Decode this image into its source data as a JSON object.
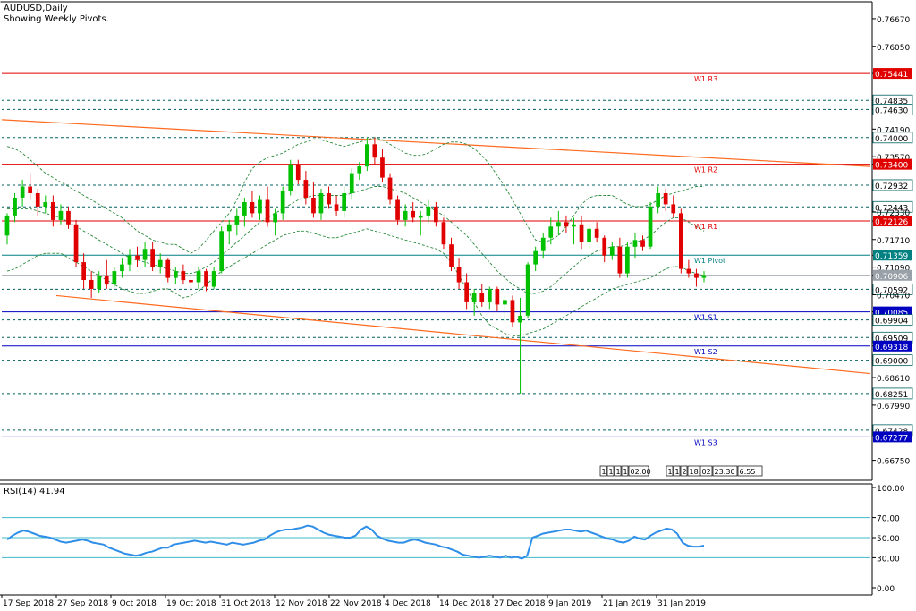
{
  "header": {
    "symbol_line": "AUDUSD,Daily",
    "pivots_line": "Showing Weekly Pivots."
  },
  "indicator": {
    "label": "RSI(14) 41.94"
  },
  "colors": {
    "bull": "#00c000",
    "bear": "#e00000",
    "pivot_res": "#e00000",
    "pivot_sup": "#0000c0",
    "pivot_mid": "#008080",
    "level": "#006060",
    "trend": "#ff6a1f",
    "band": "#2a8a3a",
    "rsi_line": "#2f8fe8",
    "rsi_level": "#40b8c8",
    "axis": "#000000"
  },
  "chart_data": [
    {
      "type": "candlestick",
      "title": "AUDUSD,Daily",
      "subtitle": "Showing Weekly Pivots.",
      "ylim": [
        0.663,
        0.7705
      ],
      "y_ticks": [
        "0.76670",
        "0.76050",
        "0.75441",
        "0.74835",
        "0.74630",
        "0.74190",
        "0.74000",
        "0.73570",
        "0.73400",
        "0.72932",
        "0.72443",
        "0.72330",
        "0.72126",
        "0.71710",
        "0.71359",
        "0.71090",
        "0.70906",
        "0.70592",
        "0.70470",
        "0.70085",
        "0.69904",
        "0.69509",
        "0.69318",
        "0.69000",
        "0.68610",
        "0.68251",
        "0.67990",
        "0.67428",
        "0.67277",
        "0.66750"
      ],
      "pivot_levels": [
        {
          "label": "W1 R3",
          "value": 0.75441,
          "kind": "res"
        },
        {
          "label": "W1 R2",
          "value": 0.734,
          "kind": "res"
        },
        {
          "label": "W1 R1",
          "value": 0.72126,
          "kind": "res"
        },
        {
          "label": "W1 Pivot",
          "value": 0.71359,
          "kind": "mid"
        },
        {
          "label": "W1 S1",
          "value": 0.70085,
          "kind": "sup"
        },
        {
          "label": "W1 S2",
          "value": 0.69318,
          "kind": "sup"
        },
        {
          "label": "W1 S3",
          "value": 0.67277,
          "kind": "sup"
        }
      ],
      "horizontal_levels": [
        0.74835,
        0.7463,
        0.74,
        0.72932,
        0.72443,
        0.70592,
        0.69904,
        0.69509,
        0.69,
        0.68251,
        0.67428
      ],
      "current_price": 0.70906,
      "x_labels": [
        "17 Sep 2018",
        "27 Sep 2018",
        "9 Oct 2018",
        "19 Oct 2018",
        "31 Oct 2018",
        "12 Nov 2018",
        "22 Nov 2018",
        "4 Dec 2018",
        "14 Dec 2018",
        "27 Dec 2018",
        "9 Jan 2019",
        "21 Jan 2019",
        "31 Jan 2019"
      ],
      "trendlines": [
        {
          "from": [
            "17 Sep 2018",
            0.744
          ],
          "to": [
            "end",
            0.7335
          ]
        },
        {
          "from": [
            "27 Sep 2018",
            0.7045
          ],
          "to": [
            "end",
            0.687
          ]
        }
      ],
      "session_labels": [
        "1",
        "1",
        "1",
        "1",
        "02:00",
        "1",
        "1",
        "2",
        "18:",
        "02",
        "23:30",
        "6:55"
      ],
      "candles": [
        [
          0.718,
          0.723,
          0.716,
          0.7225
        ],
        [
          0.7225,
          0.7275,
          0.721,
          0.7265
        ],
        [
          0.7265,
          0.7305,
          0.7245,
          0.729
        ],
        [
          0.729,
          0.732,
          0.726,
          0.7275
        ],
        [
          0.7275,
          0.7285,
          0.7225,
          0.7245
        ],
        [
          0.7245,
          0.727,
          0.723,
          0.7255
        ],
        [
          0.7255,
          0.727,
          0.72,
          0.7215
        ],
        [
          0.7215,
          0.725,
          0.7205,
          0.7235
        ],
        [
          0.7235,
          0.7245,
          0.7195,
          0.7205
        ],
        [
          0.7205,
          0.7215,
          0.711,
          0.712
        ],
        [
          0.712,
          0.714,
          0.706,
          0.708
        ],
        [
          0.708,
          0.71,
          0.704,
          0.706
        ],
        [
          0.706,
          0.71,
          0.705,
          0.709
        ],
        [
          0.709,
          0.7125,
          0.706,
          0.707
        ],
        [
          0.707,
          0.711,
          0.7065,
          0.71
        ],
        [
          0.71,
          0.713,
          0.7085,
          0.7115
        ],
        [
          0.7115,
          0.715,
          0.71,
          0.7135
        ],
        [
          0.7135,
          0.7155,
          0.711,
          0.7125
        ],
        [
          0.7125,
          0.7165,
          0.711,
          0.715
        ],
        [
          0.715,
          0.7165,
          0.71,
          0.711
        ],
        [
          0.711,
          0.714,
          0.7095,
          0.7125
        ],
        [
          0.7125,
          0.713,
          0.7075,
          0.7085
        ],
        [
          0.7085,
          0.711,
          0.707,
          0.71
        ],
        [
          0.71,
          0.7115,
          0.707,
          0.708
        ],
        [
          0.708,
          0.7095,
          0.704,
          0.7075
        ],
        [
          0.7075,
          0.711,
          0.706,
          0.71
        ],
        [
          0.71,
          0.7105,
          0.7055,
          0.7065
        ],
        [
          0.7065,
          0.711,
          0.706,
          0.71
        ],
        [
          0.71,
          0.72,
          0.7095,
          0.719
        ],
        [
          0.719,
          0.7215,
          0.716,
          0.7205
        ],
        [
          0.7205,
          0.724,
          0.718,
          0.7225
        ],
        [
          0.7225,
          0.7265,
          0.72,
          0.7255
        ],
        [
          0.7255,
          0.728,
          0.722,
          0.723
        ],
        [
          0.723,
          0.727,
          0.7215,
          0.726
        ],
        [
          0.726,
          0.729,
          0.72,
          0.721
        ],
        [
          0.721,
          0.724,
          0.718,
          0.723
        ],
        [
          0.723,
          0.729,
          0.7215,
          0.728
        ],
        [
          0.728,
          0.735,
          0.727,
          0.734
        ],
        [
          0.734,
          0.735,
          0.7295,
          0.7305
        ],
        [
          0.7305,
          0.7325,
          0.725,
          0.7265
        ],
        [
          0.7265,
          0.73,
          0.722,
          0.723
        ],
        [
          0.723,
          0.7285,
          0.7215,
          0.7275
        ],
        [
          0.7275,
          0.729,
          0.724,
          0.725
        ],
        [
          0.725,
          0.727,
          0.7225,
          0.7235
        ],
        [
          0.7235,
          0.729,
          0.722,
          0.7275
        ],
        [
          0.7275,
          0.733,
          0.726,
          0.732
        ],
        [
          0.732,
          0.7345,
          0.7305,
          0.7335
        ],
        [
          0.7335,
          0.74,
          0.7325,
          0.7385
        ],
        [
          0.7385,
          0.74,
          0.734,
          0.7355
        ],
        [
          0.7355,
          0.7375,
          0.73,
          0.731
        ],
        [
          0.731,
          0.732,
          0.725,
          0.726
        ],
        [
          0.726,
          0.727,
          0.7205,
          0.7215
        ],
        [
          0.7215,
          0.725,
          0.72,
          0.7235
        ],
        [
          0.7235,
          0.7255,
          0.721,
          0.722
        ],
        [
          0.722,
          0.7235,
          0.718,
          0.7225
        ],
        [
          0.7225,
          0.726,
          0.721,
          0.7245
        ],
        [
          0.7245,
          0.7255,
          0.72,
          0.721
        ],
        [
          0.721,
          0.722,
          0.715,
          0.716
        ],
        [
          0.716,
          0.7175,
          0.71,
          0.711
        ],
        [
          0.711,
          0.713,
          0.706,
          0.7075
        ],
        [
          0.7075,
          0.7095,
          0.7015,
          0.703
        ],
        [
          0.703,
          0.706,
          0.7,
          0.705
        ],
        [
          0.705,
          0.707,
          0.702,
          0.703
        ],
        [
          0.703,
          0.7065,
          0.7015,
          0.706
        ],
        [
          0.706,
          0.7065,
          0.701,
          0.7025
        ],
        [
          0.7025,
          0.7045,
          0.6985,
          0.7035
        ],
        [
          0.7035,
          0.7045,
          0.6975,
          0.6985
        ],
        [
          0.6985,
          0.704,
          0.6825,
          0.7
        ],
        [
          0.7,
          0.712,
          0.6995,
          0.7115
        ],
        [
          0.7115,
          0.7155,
          0.71,
          0.7145
        ],
        [
          0.7145,
          0.7185,
          0.713,
          0.7175
        ],
        [
          0.7175,
          0.722,
          0.716,
          0.72
        ],
        [
          0.72,
          0.7235,
          0.718,
          0.721
        ],
        [
          0.721,
          0.7225,
          0.7185,
          0.72
        ],
        [
          0.72,
          0.722,
          0.716,
          0.7205
        ],
        [
          0.7205,
          0.7225,
          0.715,
          0.7165
        ],
        [
          0.7165,
          0.7205,
          0.715,
          0.7195
        ],
        [
          0.7195,
          0.721,
          0.7165,
          0.7175
        ],
        [
          0.7175,
          0.718,
          0.712,
          0.7135
        ],
        [
          0.7135,
          0.7165,
          0.7125,
          0.7155
        ],
        [
          0.7155,
          0.7175,
          0.7085,
          0.7095
        ],
        [
          0.7095,
          0.7165,
          0.7085,
          0.7155
        ],
        [
          0.7155,
          0.7185,
          0.713,
          0.717
        ],
        [
          0.717,
          0.718,
          0.7145,
          0.7155
        ],
        [
          0.7155,
          0.7255,
          0.715,
          0.7245
        ],
        [
          0.7245,
          0.729,
          0.723,
          0.7275
        ],
        [
          0.7275,
          0.7285,
          0.7235,
          0.725
        ],
        [
          0.725,
          0.727,
          0.722,
          0.723
        ],
        [
          0.723,
          0.724,
          0.7095,
          0.7105
        ],
        [
          0.7105,
          0.7125,
          0.7085,
          0.7095
        ],
        [
          0.7095,
          0.7105,
          0.7065,
          0.7085
        ],
        [
          0.7085,
          0.71,
          0.7075,
          0.7091
        ]
      ],
      "band_upper": [
        0.738,
        0.7375,
        0.7365,
        0.735,
        0.7335,
        0.732,
        0.731,
        0.73,
        0.729,
        0.728,
        0.727,
        0.726,
        0.725,
        0.724,
        0.723,
        0.722,
        0.7205,
        0.719,
        0.718,
        0.717,
        0.7165,
        0.716,
        0.716,
        0.715,
        0.714,
        0.715,
        0.717,
        0.719,
        0.721,
        0.723,
        0.726,
        0.73,
        0.733,
        0.7345,
        0.7355,
        0.736,
        0.7365,
        0.7375,
        0.7385,
        0.739,
        0.7395,
        0.7395,
        0.739,
        0.7385,
        0.738,
        0.7385,
        0.739,
        0.7395,
        0.74,
        0.7395,
        0.7385,
        0.7375,
        0.7365,
        0.736,
        0.736,
        0.7365,
        0.7375,
        0.7385,
        0.739,
        0.739,
        0.7385,
        0.7375,
        0.736,
        0.734,
        0.7315,
        0.729,
        0.726,
        0.723,
        0.72,
        0.717,
        0.7165,
        0.717,
        0.718,
        0.72,
        0.7225,
        0.725,
        0.7265,
        0.727,
        0.727,
        0.727,
        0.726,
        0.725,
        0.7245,
        0.7245,
        0.725,
        0.726,
        0.727,
        0.7275,
        0.728,
        0.7285,
        0.729,
        0.729
      ],
      "band_middle": [
        0.724,
        0.724,
        0.724,
        0.724,
        0.7235,
        0.723,
        0.7225,
        0.722,
        0.721,
        0.72,
        0.719,
        0.718,
        0.717,
        0.716,
        0.715,
        0.714,
        0.713,
        0.7125,
        0.712,
        0.7115,
        0.711,
        0.7105,
        0.71,
        0.7095,
        0.7095,
        0.71,
        0.711,
        0.712,
        0.7135,
        0.715,
        0.7165,
        0.718,
        0.7195,
        0.721,
        0.722,
        0.723,
        0.724,
        0.725,
        0.726,
        0.7265,
        0.727,
        0.727,
        0.727,
        0.727,
        0.727,
        0.7275,
        0.728,
        0.7285,
        0.729,
        0.729,
        0.7285,
        0.728,
        0.7275,
        0.7265,
        0.7255,
        0.7245,
        0.7235,
        0.7225,
        0.721,
        0.7195,
        0.718,
        0.716,
        0.714,
        0.712,
        0.71,
        0.7085,
        0.707,
        0.706,
        0.705,
        0.705,
        0.7055,
        0.7065,
        0.708,
        0.7095,
        0.711,
        0.7125,
        0.7135,
        0.7145,
        0.715,
        0.7155,
        0.7155,
        0.716,
        0.7165,
        0.717,
        0.718,
        0.7195,
        0.721,
        0.722,
        0.722,
        0.721,
        0.72,
        0.719
      ],
      "band_lower": [
        0.71,
        0.7105,
        0.7115,
        0.7125,
        0.7135,
        0.714,
        0.714,
        0.714,
        0.713,
        0.712,
        0.711,
        0.71,
        0.709,
        0.708,
        0.707,
        0.706,
        0.7055,
        0.705,
        0.705,
        0.7055,
        0.706,
        0.706,
        0.705,
        0.704,
        0.7045,
        0.7055,
        0.707,
        0.7085,
        0.71,
        0.711,
        0.712,
        0.713,
        0.714,
        0.715,
        0.716,
        0.717,
        0.718,
        0.7185,
        0.719,
        0.719,
        0.7185,
        0.718,
        0.7175,
        0.7175,
        0.718,
        0.7185,
        0.719,
        0.7195,
        0.719,
        0.7185,
        0.718,
        0.7175,
        0.717,
        0.7165,
        0.716,
        0.7155,
        0.715,
        0.714,
        0.712,
        0.709,
        0.706,
        0.703,
        0.7,
        0.698,
        0.697,
        0.696,
        0.6955,
        0.6955,
        0.696,
        0.6965,
        0.697,
        0.698,
        0.699,
        0.7,
        0.701,
        0.702,
        0.703,
        0.704,
        0.705,
        0.706,
        0.7065,
        0.707,
        0.7075,
        0.708,
        0.7085,
        0.7095,
        0.7105,
        0.711,
        0.711,
        0.71,
        0.7095,
        0.709
      ]
    },
    {
      "type": "line",
      "title": "RSI(14) 41.94",
      "ylim": [
        0,
        100
      ],
      "y_ticks": [
        "100.00",
        "70.00",
        "50.00",
        "30.00",
        "0.00"
      ],
      "levels": [
        70,
        50,
        30
      ],
      "series": [
        {
          "name": "RSI(14)",
          "values": [
            48,
            52,
            55,
            57,
            56,
            54,
            52,
            51,
            50,
            48,
            46,
            45,
            46,
            47,
            48,
            47,
            45,
            44,
            43,
            40,
            38,
            36,
            34,
            33,
            32,
            33,
            35,
            36,
            38,
            40,
            40,
            43,
            44,
            45,
            46,
            47,
            46,
            45,
            46,
            45,
            44,
            43,
            45,
            44,
            43,
            44,
            45,
            47,
            48,
            52,
            55,
            57,
            58,
            58,
            59,
            60,
            62,
            61,
            58,
            55,
            53,
            52,
            51,
            50,
            50,
            52,
            58,
            61,
            58,
            52,
            49,
            47,
            46,
            45,
            45,
            47,
            48,
            47,
            45,
            44,
            43,
            41,
            40,
            38,
            36,
            33,
            32,
            31,
            30,
            31,
            32,
            31,
            30,
            32,
            30,
            31,
            29,
            32,
            50,
            52,
            54,
            55,
            56,
            57,
            58,
            58,
            57,
            56,
            57,
            55,
            53,
            51,
            49,
            48,
            46,
            45,
            47,
            51,
            49,
            48,
            52,
            55,
            57,
            59,
            58,
            54,
            45,
            42,
            41,
            41,
            41.94
          ]
        }
      ]
    }
  ]
}
